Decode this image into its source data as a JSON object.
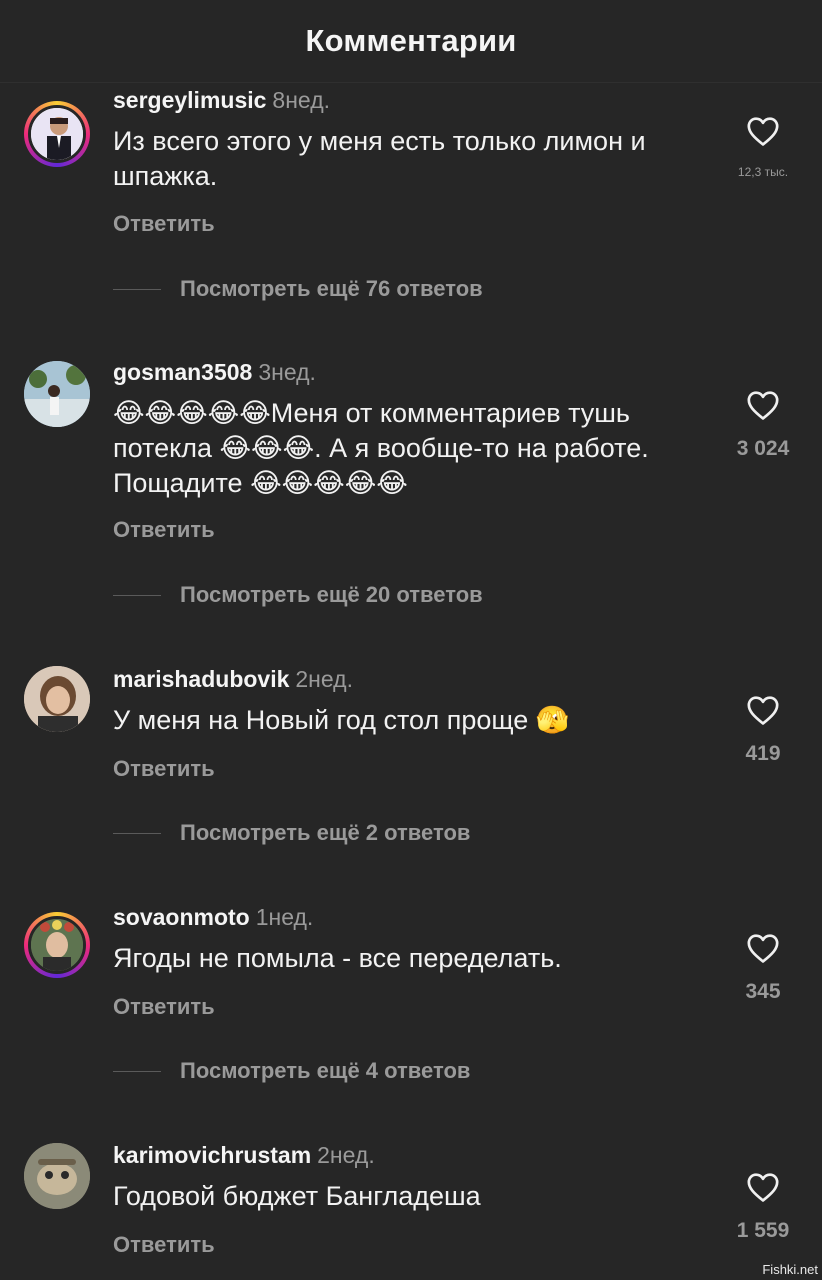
{
  "header": {
    "title": "Комментарии"
  },
  "comments": [
    {
      "username": "sergeylimusic",
      "time": "8нед.",
      "text": "Из всего этого у меня есть только лимон и шпажка.",
      "reply_label": "Ответить",
      "likes": "12,3 тыс.",
      "more_replies": "Посмотреть ещё 76 ответов"
    },
    {
      "username": "gosman3508",
      "time": "3нед.",
      "text": "😂😂😂😂😂Меня от комментариев тушь потекла 😂😂😂. А я вообще-то на работе. Пощадите 😂😂😂😂😂",
      "reply_label": "Ответить",
      "likes": "3 024",
      "more_replies": "Посмотреть ещё 20 ответов"
    },
    {
      "username": "marishadubovik",
      "time": "2нед.",
      "text": "У меня на Новый год стол проще 🫣",
      "reply_label": "Ответить",
      "likes": "419",
      "more_replies": "Посмотреть ещё 2 ответов"
    },
    {
      "username": "sovaonmoto",
      "time": "1нед.",
      "text": "Ягоды не помыла - все переделать.",
      "reply_label": "Ответить",
      "likes": "345",
      "more_replies": "Посмотреть ещё 4 ответов"
    },
    {
      "username": "karimovichrustam",
      "time": "2нед.",
      "text": "Годовой бюджет Бангладеша",
      "reply_label": "Ответить",
      "likes": "1 559"
    }
  ],
  "icons": {
    "like": "heart-outline-icon"
  },
  "watermark": "Fishki.net",
  "colors": {
    "background": "#262626",
    "secondary_text": "#9a9a9a",
    "primary_text": "#f5f5f5"
  }
}
